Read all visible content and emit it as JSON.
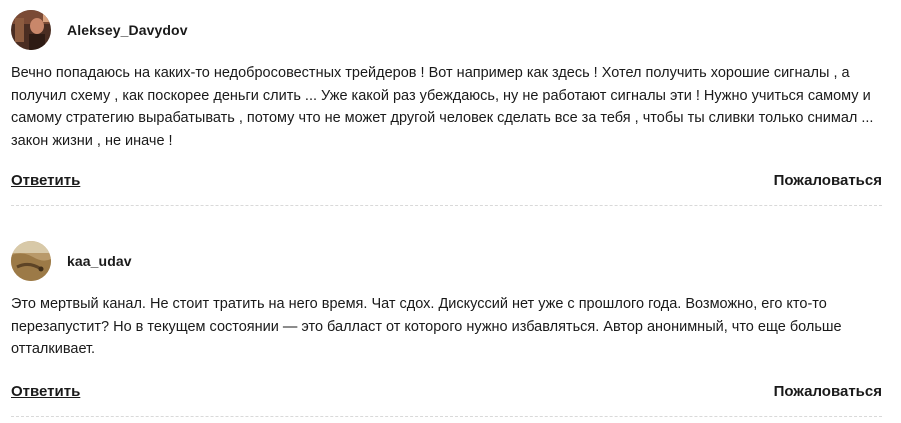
{
  "comments": [
    {
      "author": "Aleksey_Davydov",
      "text": "Вечно попадаюсь на каких-то недобросовестных трейдеров ! Вот например как здесь ! Хотел получить хорошие сигналы , а получил схему , как поскорее деньги слить ... Уже какой раз убеждаюсь, ну не работают сигналы эти ! Нужно учиться самому и самому стратегию вырабатывать , потому что не может другой человек сделать все за тебя , чтобы ты сливки только снимал ... закон жизни , не иначе !",
      "reply_label": "Ответить",
      "report_label": "Пожаловаться"
    },
    {
      "author": "kaa_udav",
      "text": "Это мертвый канал. Не стоит тратить на него время. Чат сдох. Дискуссий нет уже с прошлого года. Возможно, его кто-то перезапустит? Но в текущем состоянии — это балласт от которого нужно избавляться. Автор анонимный, что еще больше отталкивает.",
      "reply_label": "Ответить",
      "report_label": "Пожаловаться"
    }
  ]
}
